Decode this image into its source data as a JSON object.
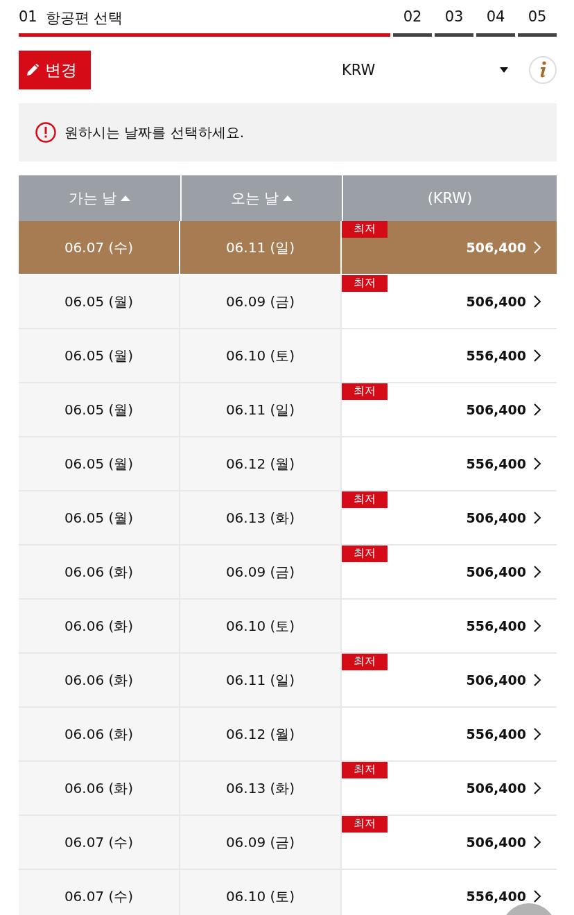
{
  "steps": [
    {
      "number": "01",
      "label": "항공편 선택",
      "selected": true
    },
    {
      "number": "02",
      "selected": false
    },
    {
      "number": "03",
      "selected": false
    },
    {
      "number": "04",
      "selected": false
    },
    {
      "number": "05",
      "selected": false
    }
  ],
  "edit_button": "변경",
  "currency": "KRW",
  "notice": "원하시는 날짜를 선택하세요.",
  "table": {
    "columns": [
      "가는 날",
      "오는 날",
      "(KRW)"
    ],
    "rows": [
      {
        "depart": "06.07 (수)",
        "return": "06.11 (일)",
        "price": "506,400",
        "badge": "최저",
        "selected": true
      },
      {
        "depart": "06.05 (월)",
        "return": "06.09 (금)",
        "price": "506,400",
        "badge": "최저",
        "selected": false
      },
      {
        "depart": "06.05 (월)",
        "return": "06.10 (토)",
        "price": "556,400",
        "selected": false
      },
      {
        "depart": "06.05 (월)",
        "return": "06.11 (일)",
        "price": "506,400",
        "badge": "최저",
        "selected": false
      },
      {
        "depart": "06.05 (월)",
        "return": "06.12 (월)",
        "price": "556,400",
        "selected": false
      },
      {
        "depart": "06.05 (월)",
        "return": "06.13 (화)",
        "price": "506,400",
        "badge": "최저",
        "selected": false
      },
      {
        "depart": "06.06 (화)",
        "return": "06.09 (금)",
        "price": "506,400",
        "badge": "최저",
        "selected": false
      },
      {
        "depart": "06.06 (화)",
        "return": "06.10 (토)",
        "price": "556,400",
        "selected": false
      },
      {
        "depart": "06.06 (화)",
        "return": "06.11 (일)",
        "price": "506,400",
        "badge": "최저",
        "selected": false
      },
      {
        "depart": "06.06 (화)",
        "return": "06.12 (월)",
        "price": "556,400",
        "selected": false
      },
      {
        "depart": "06.06 (화)",
        "return": "06.13 (화)",
        "price": "506,400",
        "badge": "최저",
        "selected": false
      },
      {
        "depart": "06.07 (수)",
        "return": "06.09 (금)",
        "price": "506,400",
        "badge": "최저",
        "selected": false
      },
      {
        "depart": "06.07 (수)",
        "return": "06.10 (토)",
        "price": "556,400",
        "selected": false
      }
    ]
  }
}
